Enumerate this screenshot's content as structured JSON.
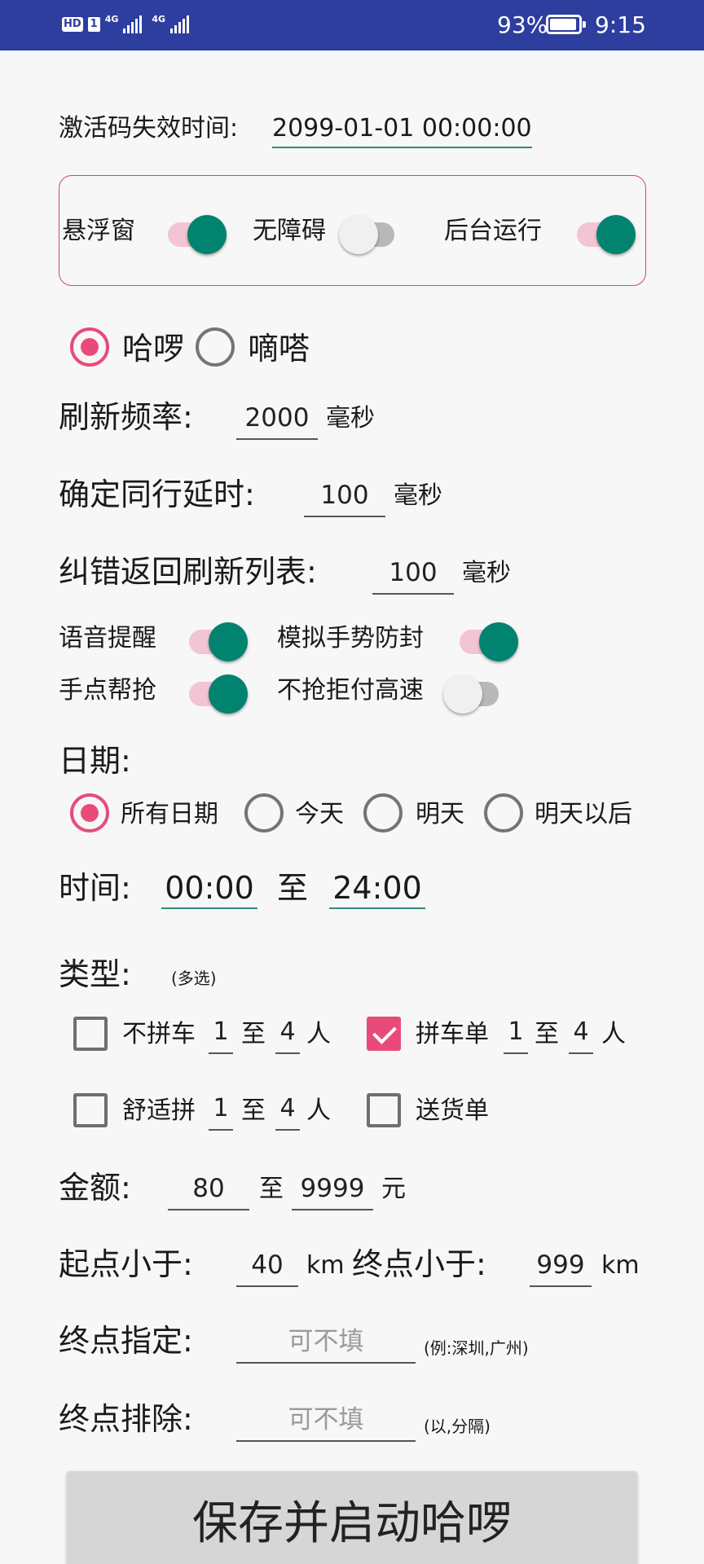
{
  "status_bar": {
    "net_label_1": "4G",
    "net_label_2": "4G",
    "hd_label": "HD",
    "sim_label": "1",
    "battery_percent": "93%",
    "battery_level": 0.93,
    "time": "9:15"
  },
  "activation": {
    "label": "激活码失效时间:",
    "value": "2099-01-01 00:00:00"
  },
  "panel": {
    "float_label": "悬浮窗",
    "float_on": true,
    "access_label": "无障碍",
    "access_on": false,
    "bg_label": "后台运行",
    "bg_on": true
  },
  "app_choice": {
    "option1": "哈啰",
    "option2": "嘀嗒",
    "selected": "哈啰"
  },
  "refresh": {
    "label": "刷新频率:",
    "value": "2000",
    "unit": "毫秒"
  },
  "confirm_delay": {
    "label": "确定同行延时:",
    "value": "100",
    "unit": "毫秒"
  },
  "correction": {
    "label": "纠错返回刷新列表:",
    "value": "100",
    "unit": "毫秒"
  },
  "toggles": {
    "voice_label": "语音提醒",
    "voice_on": true,
    "gesture_label": "模拟手势防封",
    "gesture_on": true,
    "manual_label": "手点帮抢",
    "manual_on": true,
    "highway_label": "不抢拒付高速",
    "highway_on": false
  },
  "date": {
    "label": "日期:",
    "options": [
      "所有日期",
      "今天",
      "明天",
      "明天以后"
    ],
    "selected": "所有日期"
  },
  "time": {
    "label": "时间:",
    "start": "00:00",
    "to": "至",
    "end": "24:00"
  },
  "type": {
    "label": "类型:",
    "hint": "(多选)",
    "to": "至",
    "person": "人",
    "no_carpool": {
      "label": "不拼车",
      "checked": false,
      "min": "1",
      "max": "4"
    },
    "carpool": {
      "label": "拼车单",
      "checked": true,
      "min": "1",
      "max": "4"
    },
    "comfort": {
      "label": "舒适拼",
      "checked": false,
      "min": "1",
      "max": "4"
    },
    "delivery": {
      "label": "送货单",
      "checked": false
    }
  },
  "amount": {
    "label": "金额:",
    "min": "80",
    "to": "至",
    "max": "9999",
    "unit": "元"
  },
  "distance": {
    "start_label": "起点小于:",
    "start_value": "40",
    "unit": "km",
    "end_label": "终点小于:",
    "end_value": "999"
  },
  "dest_specify": {
    "label": "终点指定:",
    "placeholder": "可不填",
    "hint": "(例:深圳,广州)"
  },
  "dest_exclude": {
    "label": "终点排除:",
    "placeholder": "可不填",
    "hint": "(以,分隔)"
  },
  "save_button": "保存并启动哈啰"
}
